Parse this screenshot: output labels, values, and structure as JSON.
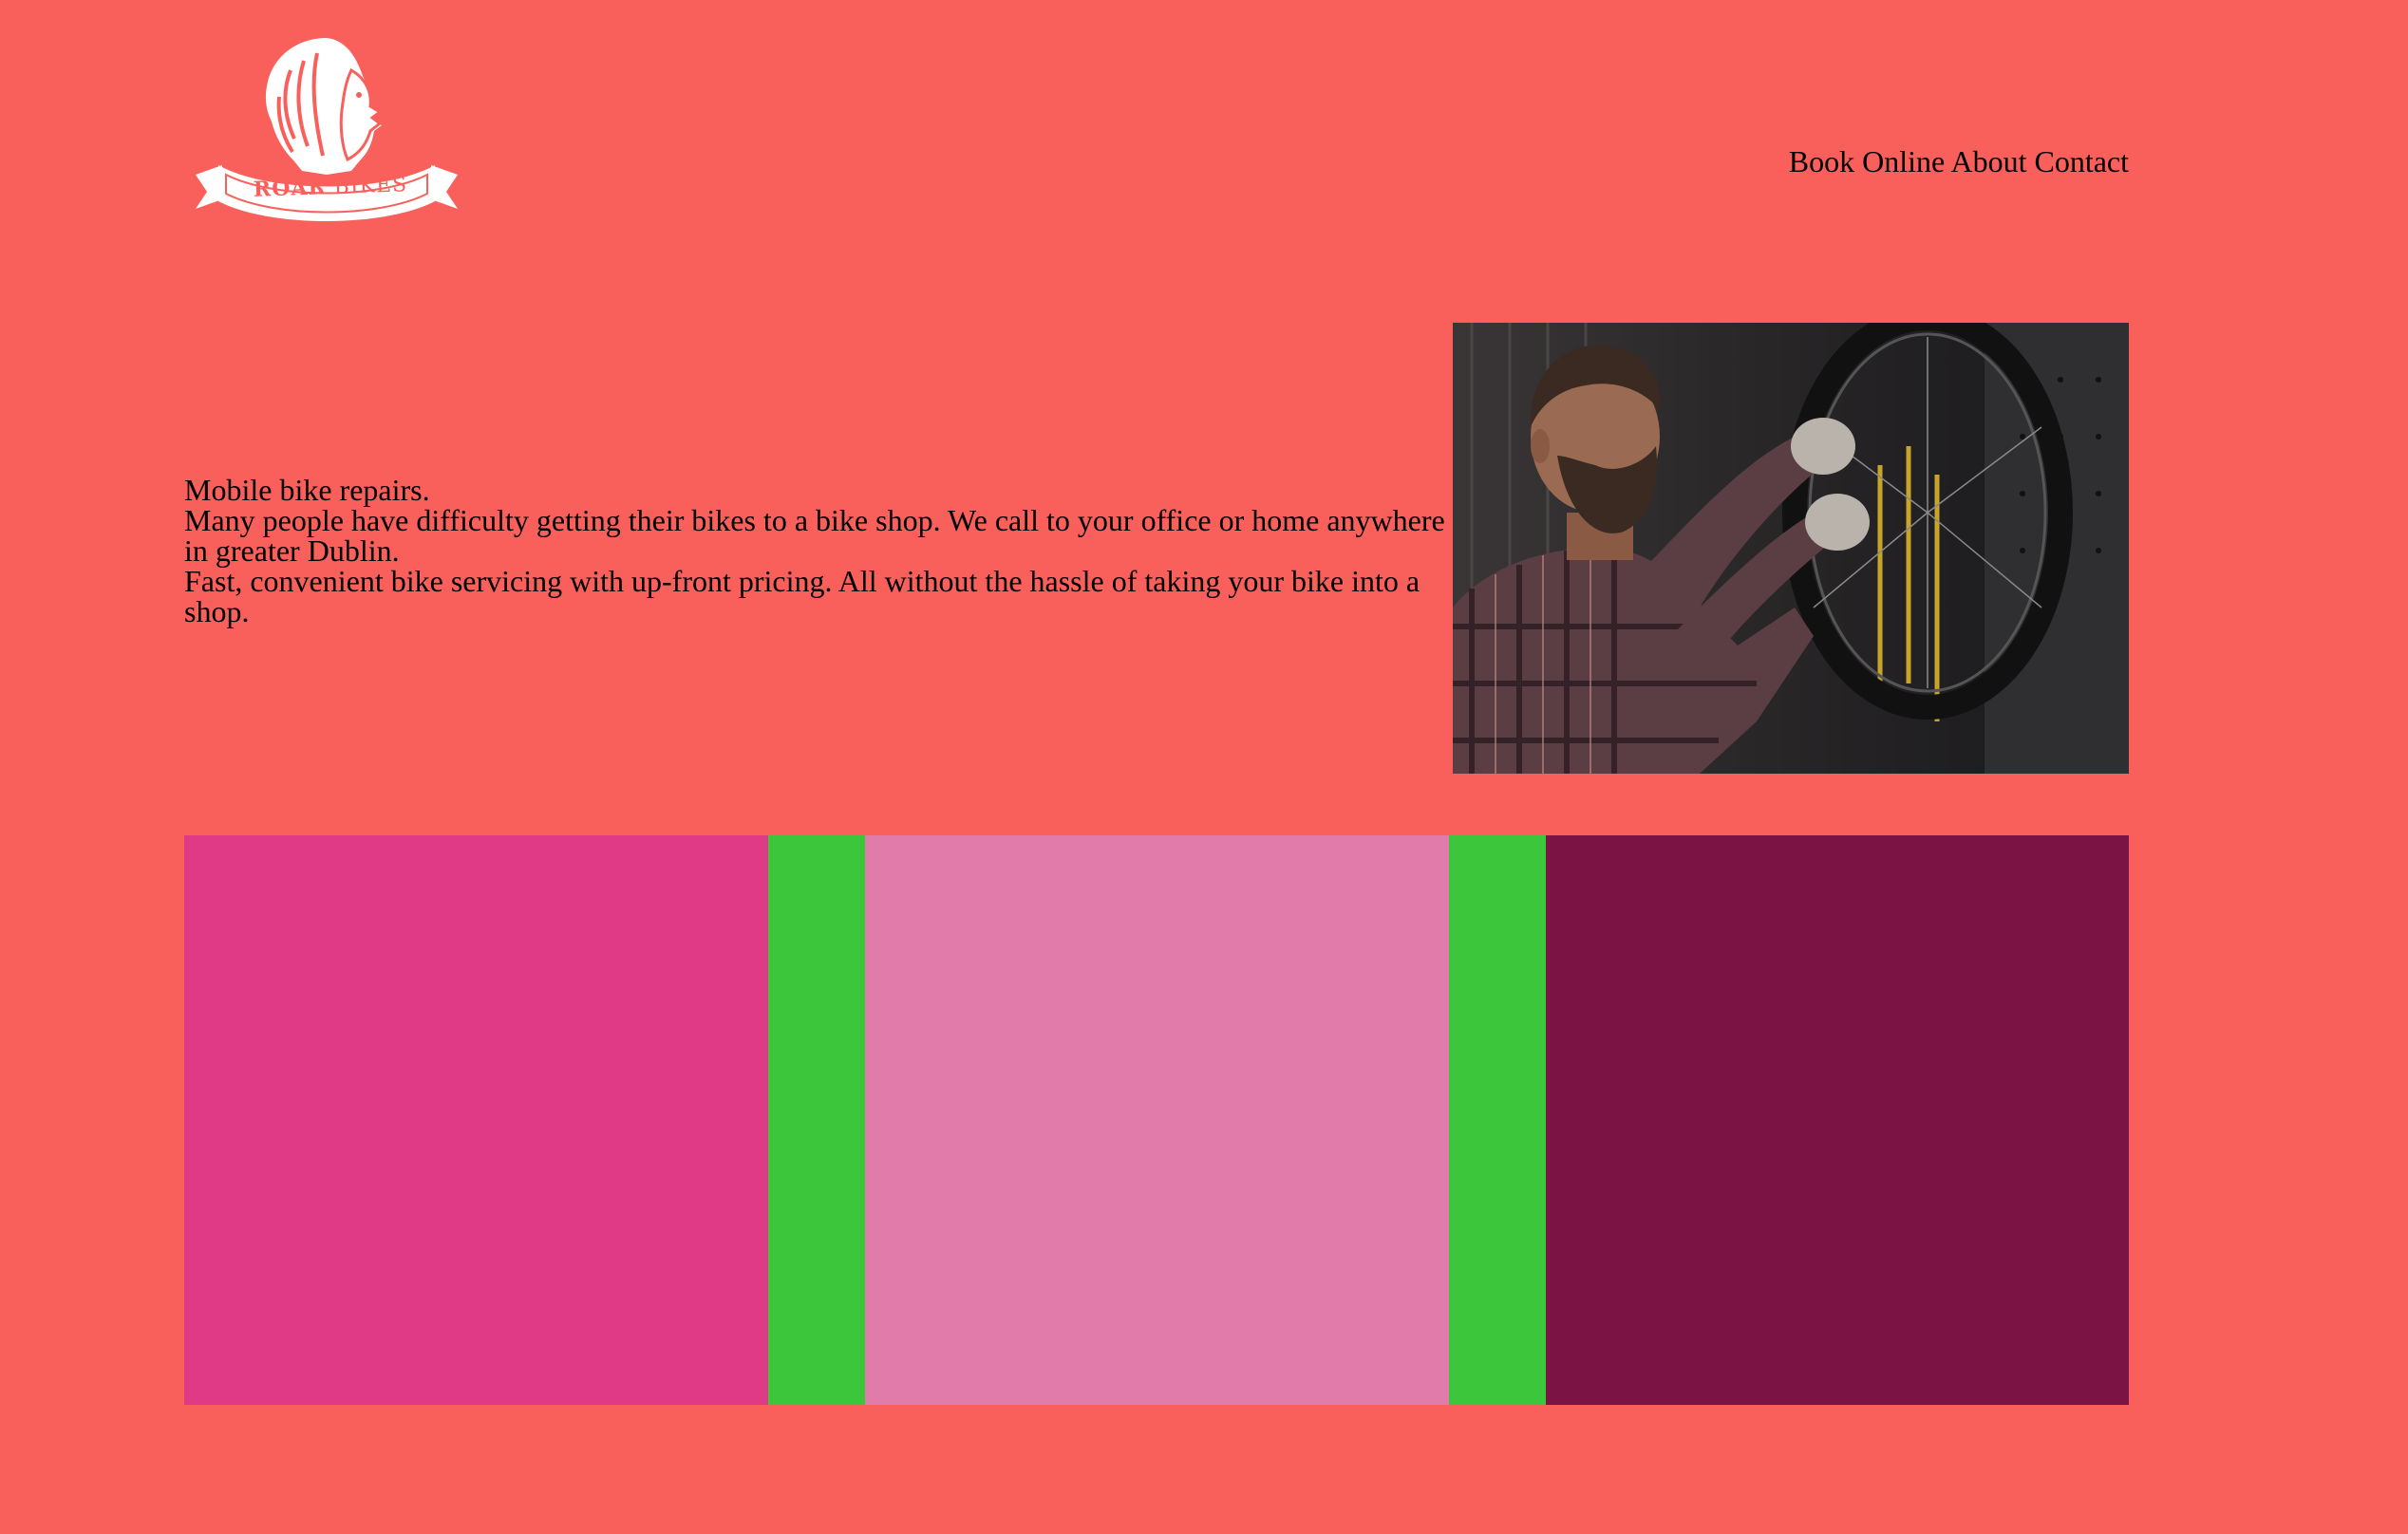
{
  "brand": {
    "logo_text_bold": "ROAR",
    "logo_text_light": "BIKES",
    "logo_icon": "lion-head-icon"
  },
  "nav": {
    "items": [
      {
        "label": "Book Online"
      },
      {
        "label": "About"
      },
      {
        "label": "Contact"
      }
    ]
  },
  "hero": {
    "heading": "Mobile bike repairs.",
    "paragraph_1": "Many people have difficulty getting their bikes to a bike shop. We call to your office or home anywhere in greater Dublin.",
    "paragraph_2": "Fast, convenient bike servicing with up-front pricing. All without the hassle of taking your bike into a shop.",
    "image_subject": "mechanic repairing bicycle wheel in workshop"
  },
  "colors": {
    "page_background": "#f9605b",
    "logo": "#ffffff",
    "tile_1": "#e03a86",
    "gutter": "#3cc63c",
    "tile_2": "#e17ba9",
    "tile_3": "#7b1444"
  }
}
